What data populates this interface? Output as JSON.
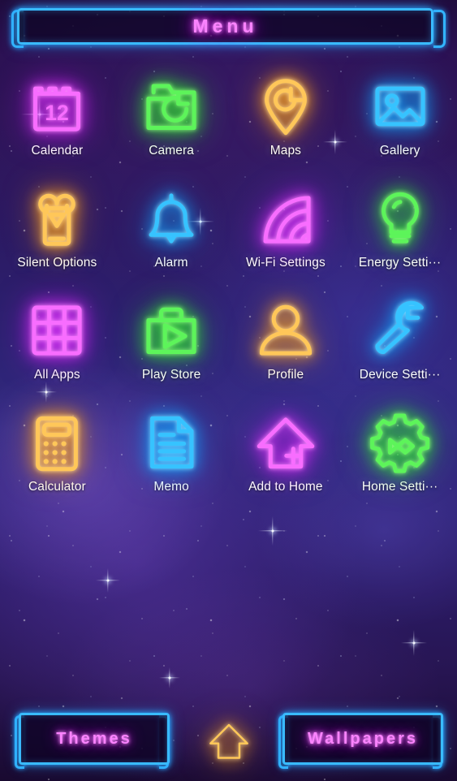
{
  "header": {
    "title": "Menu",
    "title_color": "#fb83ff",
    "border_color": "#39bbff"
  },
  "theme": {
    "neon_pink": "#f86dff",
    "neon_green": "#5df45a",
    "neon_amber": "#ffc759",
    "neon_cyan": "#36c3ff",
    "label_color": "#ffffff",
    "background_top": "#2a1050",
    "background_mid": "#322a80",
    "background_bottom": "#190a30"
  },
  "grid": {
    "columns": 4,
    "rows": 4,
    "items": [
      {
        "label": "Calendar",
        "icon": "calendar-icon",
        "color": "pink",
        "badge": "12"
      },
      {
        "label": "Camera",
        "icon": "camera-icon",
        "color": "green"
      },
      {
        "label": "Maps",
        "icon": "map-pin-icon",
        "color": "amber"
      },
      {
        "label": "Gallery",
        "icon": "image-icon",
        "color": "cyan"
      },
      {
        "label": "Silent Options",
        "icon": "silent-phone-icon",
        "color": "amber"
      },
      {
        "label": "Alarm",
        "icon": "bell-icon",
        "color": "cyan"
      },
      {
        "label": "Wi-Fi Settings",
        "icon": "wifi-icon",
        "color": "pink"
      },
      {
        "label": "Energy Setti···",
        "icon": "lightbulb-icon",
        "color": "green"
      },
      {
        "label": "All Apps",
        "icon": "grid-apps-icon",
        "color": "pink"
      },
      {
        "label": "Play Store",
        "icon": "play-briefcase-icon",
        "color": "green"
      },
      {
        "label": "Profile",
        "icon": "person-icon",
        "color": "amber"
      },
      {
        "label": "Device Setti···",
        "icon": "wrench-icon",
        "color": "cyan"
      },
      {
        "label": "Calculator",
        "icon": "calculator-icon",
        "color": "amber"
      },
      {
        "label": "Memo",
        "icon": "document-icon",
        "color": "cyan"
      },
      {
        "label": "Add to Home",
        "icon": "house-plus-icon",
        "color": "pink"
      },
      {
        "label": "Home Setti···",
        "icon": "gear-icon",
        "color": "green"
      }
    ]
  },
  "bottom_bar": {
    "themes_label": "Themes",
    "home_icon": "home-icon",
    "wallpapers_label": "Wallpapers"
  }
}
